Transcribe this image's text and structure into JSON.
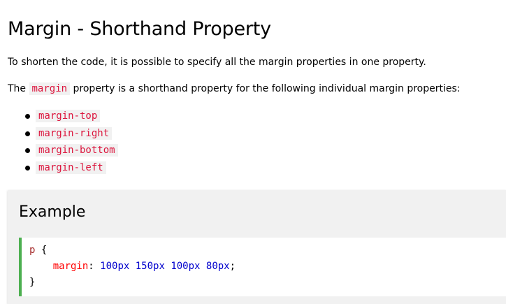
{
  "heading": "Margin - Shorthand Property",
  "intro": "To shorten the code, it is possible to specify all the margin properties in one property.",
  "shorthand_sentence": {
    "before": "The ",
    "code": "margin",
    "after": " property is a shorthand property for the following individual margin properties:"
  },
  "properties": [
    "margin-top",
    "margin-right",
    "margin-bottom",
    "margin-left"
  ],
  "example": {
    "title": "Example",
    "code": {
      "selector": "p",
      "open_brace": "{",
      "property": "margin",
      "colon": ":",
      "value": "100px 150px 100px 80px",
      "semicolon": ";",
      "close_brace": "}"
    }
  },
  "colors": {
    "inline_code_text": "#dc143c",
    "inline_code_bg": "#f1f1f1",
    "example_bg": "#f1f1f1",
    "code_border_accent": "#4caf50",
    "code_selector": "#a52a2a",
    "code_property": "#ff0000",
    "code_value": "#0000cd"
  }
}
